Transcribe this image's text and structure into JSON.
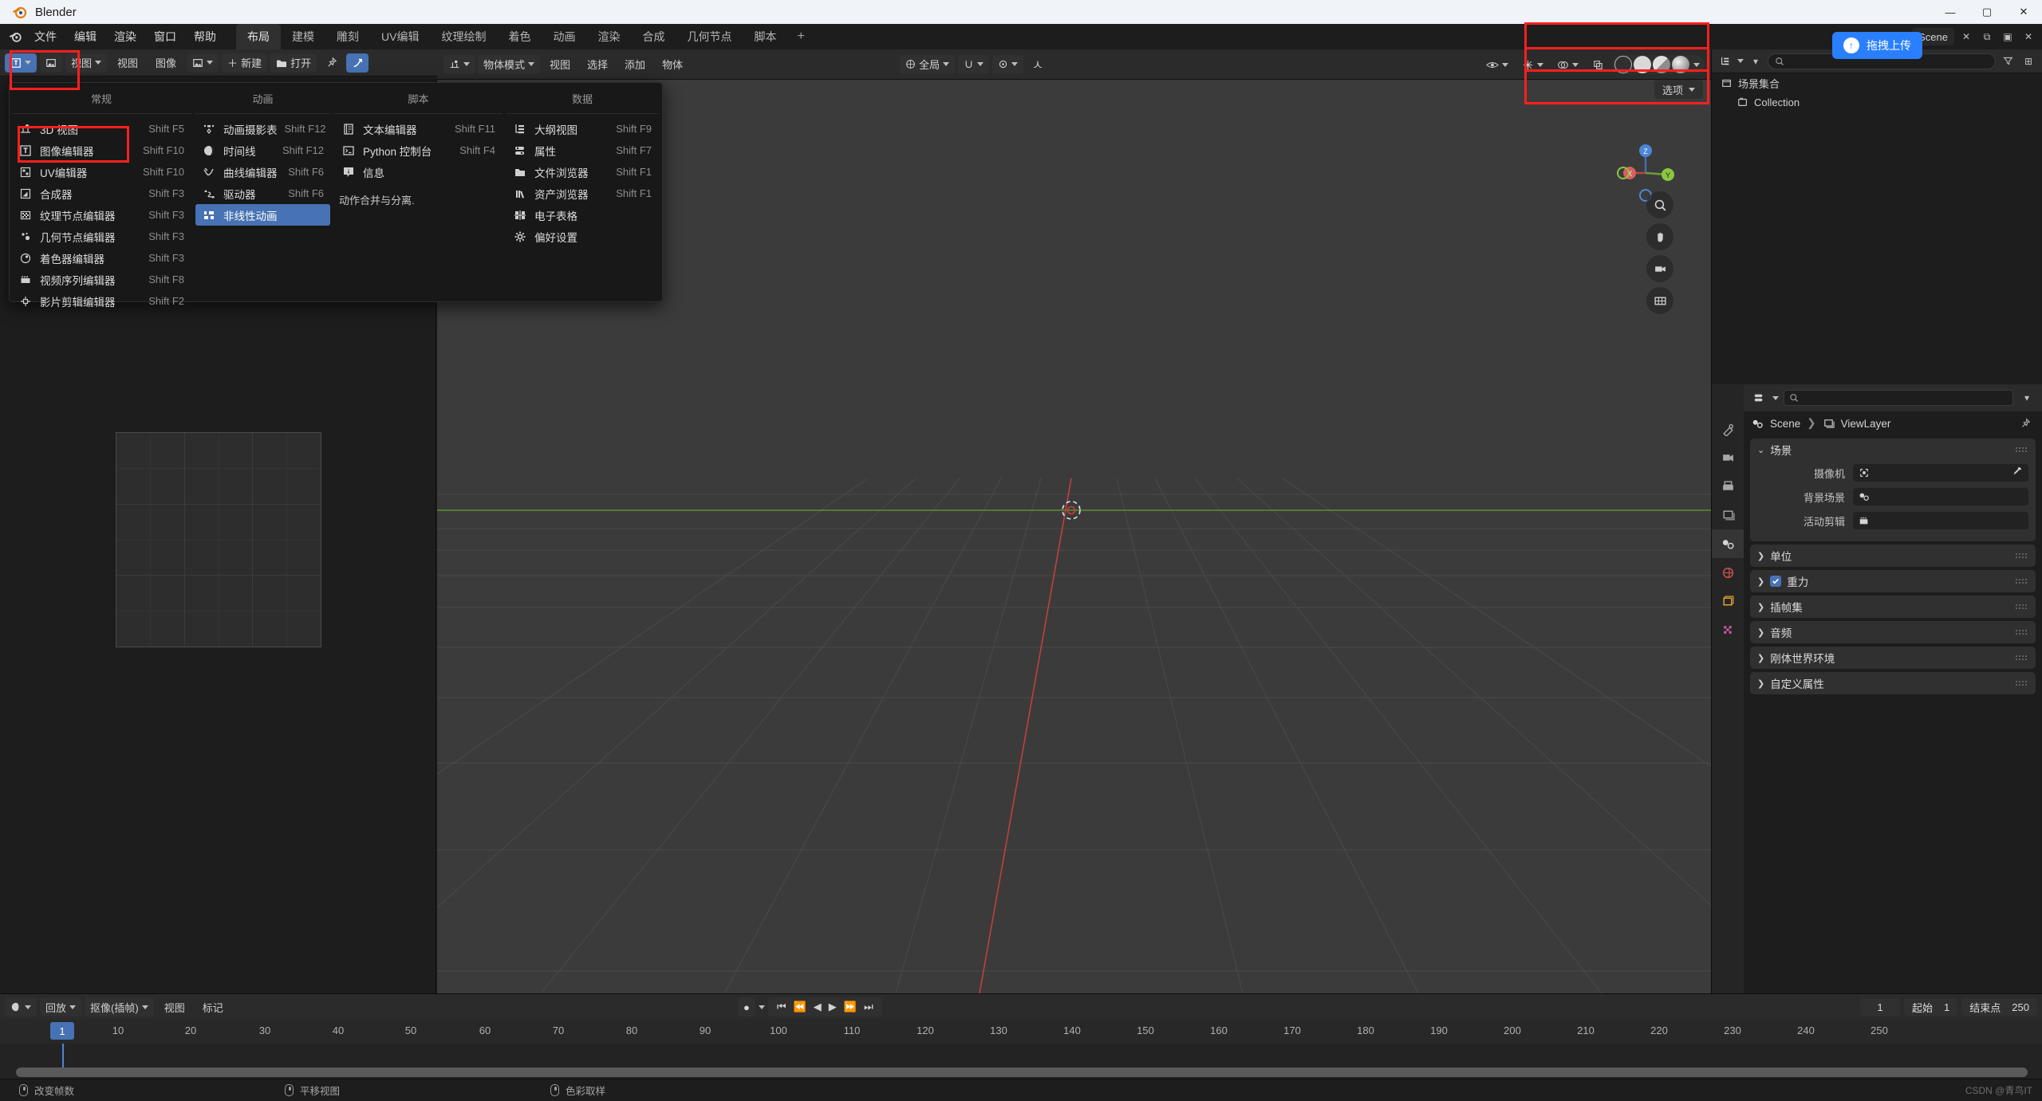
{
  "window": {
    "title": "Blender",
    "minimize": "—",
    "maximize": "▢",
    "close": "✕"
  },
  "topbar": {
    "menus": [
      "文件",
      "编辑",
      "渲染",
      "窗口",
      "帮助"
    ],
    "workspaces": [
      "布局",
      "建模",
      "雕刻",
      "UV编辑",
      "纹理绘制",
      "着色",
      "动画",
      "渲染",
      "合成",
      "几何节点",
      "脚本"
    ],
    "active_workspace": "布局",
    "add_workspace": "+",
    "scene_name": "Scene",
    "view_layer_name": "ViewLayer"
  },
  "editor_header": {
    "editor_type_label": "图像编辑器",
    "mode_label": "视图",
    "menus": [
      "视图",
      "图像"
    ],
    "new_label": "新建",
    "open_label": "打开",
    "blend_mode": "全局",
    "object_mode": "物体模式",
    "viewport_menus": [
      "视图",
      "选择",
      "添加",
      "物体"
    ],
    "options_label": "选项"
  },
  "editor_menu": {
    "columns": [
      {
        "header": "常规",
        "items": [
          {
            "icon": "3d-view-icon",
            "label": "3D 视图",
            "shortcut": "Shift F5",
            "selected": false
          },
          {
            "icon": "image-editor-icon",
            "label": "图像编辑器",
            "shortcut": "Shift F10",
            "selected": false
          },
          {
            "icon": "uv-editor-icon",
            "label": "UV编辑器",
            "shortcut": "Shift F10",
            "selected": false
          },
          {
            "icon": "compositor-icon",
            "label": "合成器",
            "shortcut": "Shift F3",
            "selected": false
          },
          {
            "icon": "texture-node-icon",
            "label": "纹理节点编辑器",
            "shortcut": "Shift F3",
            "selected": false
          },
          {
            "icon": "geometry-node-icon",
            "label": "几何节点编辑器",
            "shortcut": "Shift F3",
            "selected": false
          },
          {
            "icon": "shader-editor-icon",
            "label": "着色器编辑器",
            "shortcut": "Shift F3",
            "selected": false
          },
          {
            "icon": "video-sequencer-icon",
            "label": "视频序列编辑器",
            "shortcut": "Shift F8",
            "selected": false
          },
          {
            "icon": "movie-clip-icon",
            "label": "影片剪辑编辑器",
            "shortcut": "Shift F2",
            "selected": false
          }
        ]
      },
      {
        "header": "动画",
        "items": [
          {
            "icon": "dope-sheet-icon",
            "label": "动画摄影表",
            "shortcut": "Shift F12",
            "selected": false
          },
          {
            "icon": "timeline-icon",
            "label": "时间线",
            "shortcut": "Shift F12",
            "selected": false
          },
          {
            "icon": "graph-editor-icon",
            "label": "曲线编辑器",
            "shortcut": "Shift F6",
            "selected": false
          },
          {
            "icon": "drivers-icon",
            "label": "驱动器",
            "shortcut": "Shift F6",
            "selected": false
          },
          {
            "icon": "nla-editor-icon",
            "label": "非线性动画",
            "shortcut": "",
            "selected": true
          }
        ]
      },
      {
        "header": "脚本",
        "items": [
          {
            "icon": "text-editor-icon",
            "label": "文本编辑器",
            "shortcut": "Shift F11",
            "selected": false
          },
          {
            "icon": "python-console-icon",
            "label": "Python 控制台",
            "shortcut": "Shift F4",
            "selected": false
          },
          {
            "icon": "info-icon",
            "label": "信息",
            "shortcut": "",
            "selected": false
          }
        ]
      },
      {
        "header": "数据",
        "items": [
          {
            "icon": "outliner-icon",
            "label": "大纲视图",
            "shortcut": "Shift F9",
            "selected": false
          },
          {
            "icon": "properties-icon",
            "label": "属性",
            "shortcut": "Shift F7",
            "selected": false
          },
          {
            "icon": "file-browser-icon",
            "label": "文件浏览器",
            "shortcut": "Shift F1",
            "selected": false
          },
          {
            "icon": "asset-browser-icon",
            "label": "资产浏览器",
            "shortcut": "Shift F1",
            "selected": false
          },
          {
            "icon": "spreadsheet-icon",
            "label": "电子表格",
            "shortcut": "",
            "selected": false
          },
          {
            "icon": "preferences-icon",
            "label": "偏好设置",
            "shortcut": "",
            "selected": false
          }
        ]
      }
    ],
    "footer_note": "动作合并与分离."
  },
  "outliner": {
    "search_placeholder": "",
    "scene_collection": "场景集合",
    "collection": "Collection"
  },
  "properties": {
    "search_placeholder": "",
    "breadcrumb_scene": "Scene",
    "breadcrumb_viewlayer": "ViewLayer",
    "panels": [
      {
        "label": "场景",
        "open": true,
        "checkbox": false
      },
      {
        "label": "单位",
        "open": false,
        "checkbox": false
      },
      {
        "label": "重力",
        "open": false,
        "checkbox": true
      },
      {
        "label": "插帧集",
        "open": false,
        "checkbox": false
      },
      {
        "label": "音频",
        "open": false,
        "checkbox": false
      },
      {
        "label": "刚体世界环境",
        "open": false,
        "checkbox": false
      },
      {
        "label": "自定义属性",
        "open": false,
        "checkbox": false
      }
    ],
    "scene_fields": [
      {
        "label": "摄像机",
        "value": "",
        "icon": "camera-icon",
        "has_eyedropper": true
      },
      {
        "label": "背景场景",
        "value": "",
        "icon": "scene-icon",
        "has_eyedropper": false
      },
      {
        "label": "活动剪辑",
        "value": "",
        "icon": "clip-icon",
        "has_eyedropper": false
      }
    ]
  },
  "timeline": {
    "editor_label": "时间线",
    "playback_menu": "回放",
    "keying_menu": "抠像(插帧)",
    "view_menu": "视图",
    "marker_menu": "标记",
    "current_frame": "1",
    "start_label": "起始",
    "start_value": "1",
    "end_label": "结束点",
    "end_value": "250",
    "ticks": [
      "1",
      "10",
      "20",
      "30",
      "40",
      "50",
      "60",
      "70",
      "80",
      "90",
      "100",
      "110",
      "120",
      "130",
      "140",
      "150",
      "160",
      "170",
      "180",
      "190",
      "200",
      "210",
      "220",
      "230",
      "240",
      "250"
    ]
  },
  "statusbar": {
    "items": [
      "改变帧数",
      "平移视图",
      "色彩取样"
    ],
    "watermark": "CSDN @青鸟IT"
  },
  "upload_widget": {
    "label": "拖拽上传"
  },
  "colors": {
    "accent_blue": "#4772b3",
    "highlight_red": "#ff1f1f",
    "upload_blue": "#2a7fff",
    "viewport_bg": "#3b3b3b",
    "x_axis": "#c04040",
    "y_axis": "#5f8f2e"
  }
}
